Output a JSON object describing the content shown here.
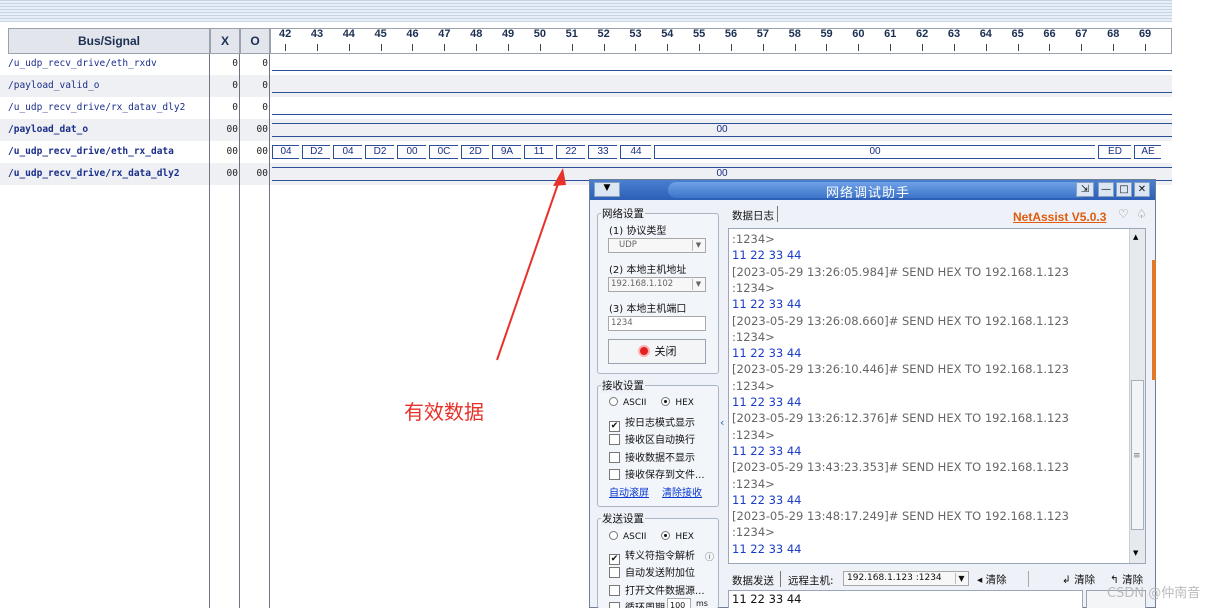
{
  "waveform": {
    "headers": {
      "name": "Bus/Signal",
      "x": "X",
      "o": "O"
    },
    "ticks": [
      "42",
      "43",
      "44",
      "45",
      "46",
      "47",
      "48",
      "49",
      "50",
      "51",
      "52",
      "53",
      "54",
      "55",
      "56",
      "57",
      "58",
      "59",
      "60",
      "61",
      "62",
      "63",
      "64",
      "65",
      "66",
      "67",
      "68",
      "69"
    ],
    "signals": [
      {
        "name": "/u_udp_recv_drive/eth_rxdv",
        "x": "0",
        "o": "0",
        "bold": false
      },
      {
        "name": "/payload_valid_o",
        "x": "0",
        "o": "0",
        "bold": false
      },
      {
        "name": "/u_udp_recv_drive/rx_datav_dly2",
        "x": "0",
        "o": "0",
        "bold": false
      },
      {
        "name": "/payload_dat_o",
        "x": "00",
        "o": "00",
        "bold": true
      },
      {
        "name": "/u_udp_recv_drive/eth_rx_data",
        "x": "00",
        "o": "00",
        "bold": true
      },
      {
        "name": "/u_udp_recv_drive/rx_data_dly2",
        "x": "00",
        "o": "00",
        "bold": true
      }
    ],
    "bus_payload_value": "00",
    "bus_rx_data_segments": [
      "04",
      "D2",
      "04",
      "D2",
      "00",
      "0C",
      "2D",
      "9A",
      "11",
      "22",
      "33",
      "44",
      "00",
      "ED",
      "AE"
    ],
    "bus_rx_dly2_value": "00"
  },
  "annotation": {
    "text": "有效数据",
    "color": "#e8312a"
  },
  "netassist": {
    "title": "网络调试助手",
    "menu_icon": "▼",
    "controls": [
      "⇲",
      "—",
      "□",
      "✕"
    ],
    "net_settings": {
      "label": "网络设置",
      "protocol_label": "(1) 协议类型",
      "protocol_value": "UDP",
      "host_label": "(2) 本地主机地址",
      "host_value": "192.168.1.102",
      "port_label": "(3) 本地主机端口",
      "port_value": "1234",
      "close_button": "关闭"
    },
    "recv_settings": {
      "label": "接收设置",
      "ascii": "ASCII",
      "hex": "HEX",
      "opts": [
        {
          "label": "按日志模式显示",
          "checked": true
        },
        {
          "label": "接收区自动换行",
          "checked": false
        },
        {
          "label": "接收数据不显示",
          "checked": false
        },
        {
          "label": "接收保存到文件...",
          "checked": false
        }
      ],
      "auto_scroll": "自动滚屏",
      "clear_recv": "清除接收"
    },
    "send_settings": {
      "label": "发送设置",
      "ascii": "ASCII",
      "hex": "HEX",
      "opts": [
        {
          "label": "转义符指令解析",
          "checked": true
        },
        {
          "label": "自动发送附加位",
          "checked": false
        },
        {
          "label": "打开文件数据源...",
          "checked": false
        },
        {
          "label": "循环周期",
          "checked": false
        }
      ],
      "period_value": "100",
      "period_unit": "ms"
    },
    "log_tab": "数据日志",
    "brand": "NetAssist V5.0.3",
    "log_lines": [
      {
        "t": ":1234>",
        "k": "meta"
      },
      {
        "t": "11 22 33 44",
        "k": "data"
      },
      {
        "t": "[2023-05-29 13:26:05.984]# SEND HEX TO 192.168.1.123",
        "k": "meta"
      },
      {
        "t": ":1234>",
        "k": "meta"
      },
      {
        "t": "11 22 33 44",
        "k": "data"
      },
      {
        "t": "[2023-05-29 13:26:08.660]# SEND HEX TO 192.168.1.123",
        "k": "meta"
      },
      {
        "t": ":1234>",
        "k": "meta"
      },
      {
        "t": "11 22 33 44",
        "k": "data"
      },
      {
        "t": "[2023-05-29 13:26:10.446]# SEND HEX TO 192.168.1.123",
        "k": "meta"
      },
      {
        "t": ":1234>",
        "k": "meta"
      },
      {
        "t": "11 22 33 44",
        "k": "data"
      },
      {
        "t": "[2023-05-29 13:26:12.376]# SEND HEX TO 192.168.1.123",
        "k": "meta"
      },
      {
        "t": ":1234>",
        "k": "meta"
      },
      {
        "t": "11 22 33 44",
        "k": "data"
      },
      {
        "t": "[2023-05-29 13:43:23.353]# SEND HEX TO 192.168.1.123",
        "k": "meta"
      },
      {
        "t": ":1234>",
        "k": "meta"
      },
      {
        "t": "11 22 33 44",
        "k": "data"
      },
      {
        "t": "[2023-05-29 13:48:17.249]# SEND HEX TO 192.168.1.123",
        "k": "meta"
      },
      {
        "t": ":1234>",
        "k": "meta"
      },
      {
        "t": "11 22 33 44",
        "k": "data"
      }
    ],
    "send_bar": {
      "tab": "数据发送",
      "remote_label": "远程主机:",
      "remote_value": "192.168.1.123 :1234",
      "clear1": "清除",
      "clear2": "清除",
      "clear3": "清除"
    },
    "send_text": "11 22 33 44"
  },
  "watermark": "CSDN @仲南音"
}
